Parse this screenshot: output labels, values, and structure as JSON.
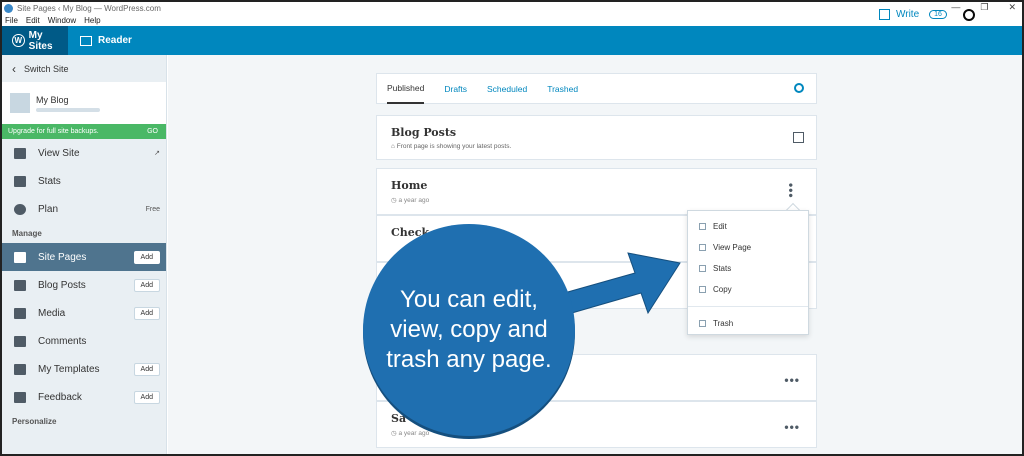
{
  "window": {
    "title": "Site Pages ‹ My Blog — WordPress.com",
    "menu": [
      "File",
      "Edit",
      "Window",
      "Help"
    ],
    "controls": [
      "—",
      "❐",
      "✕"
    ]
  },
  "topnav": {
    "mysites_label": "My Sites",
    "reader_label": "Reader",
    "write_label": "Write",
    "write_count": "16"
  },
  "sidebar": {
    "switch_site": "Switch Site",
    "site_name": "My Blog",
    "upgrade_text": "Upgrade for full site backups.",
    "upgrade_go": "GO",
    "items_top": [
      {
        "label": "View Site",
        "right": "↗"
      },
      {
        "label": "Stats",
        "right": ""
      },
      {
        "label": "Plan",
        "right": "Free"
      }
    ],
    "manage_heading": "Manage",
    "items_manage": [
      {
        "label": "Site Pages",
        "add": "Add"
      },
      {
        "label": "Blog Posts",
        "add": "Add"
      },
      {
        "label": "Media",
        "add": "Add"
      },
      {
        "label": "Comments",
        "add": ""
      },
      {
        "label": "My Templates",
        "add": "Add"
      },
      {
        "label": "Feedback",
        "add": "Add"
      }
    ],
    "personalize_heading": "Personalize"
  },
  "tabs": [
    "Published",
    "Drafts",
    "Scheduled",
    "Trashed"
  ],
  "blog_posts": {
    "title": "Blog Posts",
    "subtitle": "Front page is showing your latest posts."
  },
  "pages": [
    {
      "title": "Home",
      "time": "a year ago"
    },
    {
      "title": "Check",
      "time": ""
    },
    {
      "title": "",
      "time": ""
    },
    {
      "title": "",
      "time": ""
    },
    {
      "title": "Sa",
      "time": "a year ago"
    }
  ],
  "menu_popup": {
    "items": [
      "Edit",
      "View Page",
      "Stats",
      "Copy"
    ],
    "trash": "Trash"
  },
  "callout": {
    "text": "You can edit, view, copy and trash any page."
  }
}
